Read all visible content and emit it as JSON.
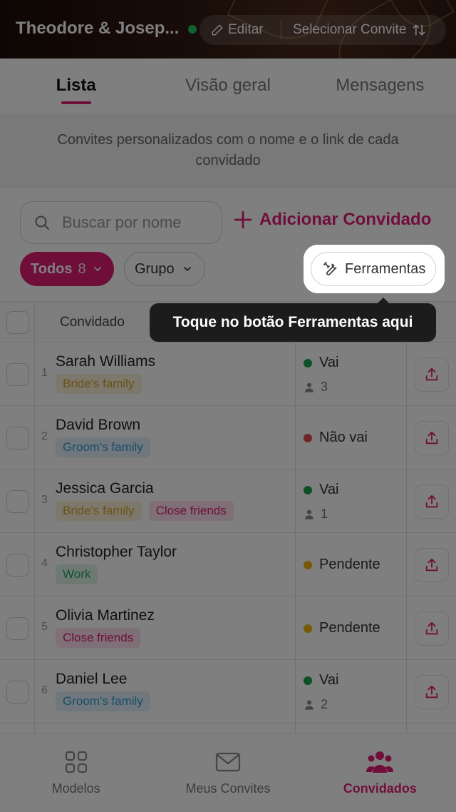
{
  "header": {
    "title": "Theodore & Josep...",
    "edit_label": "Editar",
    "select_label": "Selecionar Convite"
  },
  "tabs": [
    {
      "label": "Lista",
      "active": true
    },
    {
      "label": "Visão geral",
      "active": false
    },
    {
      "label": "Mensagens",
      "active": false
    }
  ],
  "description": "Convites personalizados com o nome e o link de cada convidado",
  "search": {
    "placeholder": "Buscar por nome"
  },
  "add_guest_label": "Adicionar Convidado",
  "filters": {
    "all_label": "Todos",
    "all_count": "8",
    "group_label": "Grupo",
    "tools_label": "Ferramentas"
  },
  "table": {
    "header_label": "Convidado",
    "rows": [
      {
        "num": "1",
        "name": "Sarah Williams",
        "tags": [
          {
            "label": "Bride's family",
            "kind": "bride"
          }
        ],
        "status": "Vai",
        "status_color": "#16a34a",
        "party": "3"
      },
      {
        "num": "2",
        "name": "David Brown",
        "tags": [
          {
            "label": "Groom's family",
            "kind": "groom"
          }
        ],
        "status": "Não vai",
        "status_color": "#e5484d",
        "party": ""
      },
      {
        "num": "3",
        "name": "Jessica Garcia",
        "tags": [
          {
            "label": "Bride's family",
            "kind": "bride"
          },
          {
            "label": "Close friends",
            "kind": "friends"
          }
        ],
        "status": "Vai",
        "status_color": "#16a34a",
        "party": "1"
      },
      {
        "num": "4",
        "name": "Christopher Taylor",
        "tags": [
          {
            "label": "Work",
            "kind": "work"
          }
        ],
        "status": "Pendente",
        "status_color": "#eab308",
        "party": ""
      },
      {
        "num": "5",
        "name": "Olivia Martinez",
        "tags": [
          {
            "label": "Close friends",
            "kind": "friends"
          }
        ],
        "status": "Pendente",
        "status_color": "#eab308",
        "party": ""
      },
      {
        "num": "6",
        "name": "Daniel Lee",
        "tags": [
          {
            "label": "Groom's family",
            "kind": "groom"
          }
        ],
        "status": "Vai",
        "status_color": "#16a34a",
        "party": "2"
      }
    ]
  },
  "tooltip": "Toque no botão Ferramentas aqui",
  "bottom_nav": [
    {
      "label": "Modelos",
      "icon": "grid-icon",
      "active": false
    },
    {
      "label": "Meus Convites",
      "icon": "envelope-icon",
      "active": false
    },
    {
      "label": "Convidados",
      "icon": "people-icon",
      "active": true
    }
  ],
  "colors": {
    "accent": "#e11d74",
    "online": "#22c55e"
  }
}
